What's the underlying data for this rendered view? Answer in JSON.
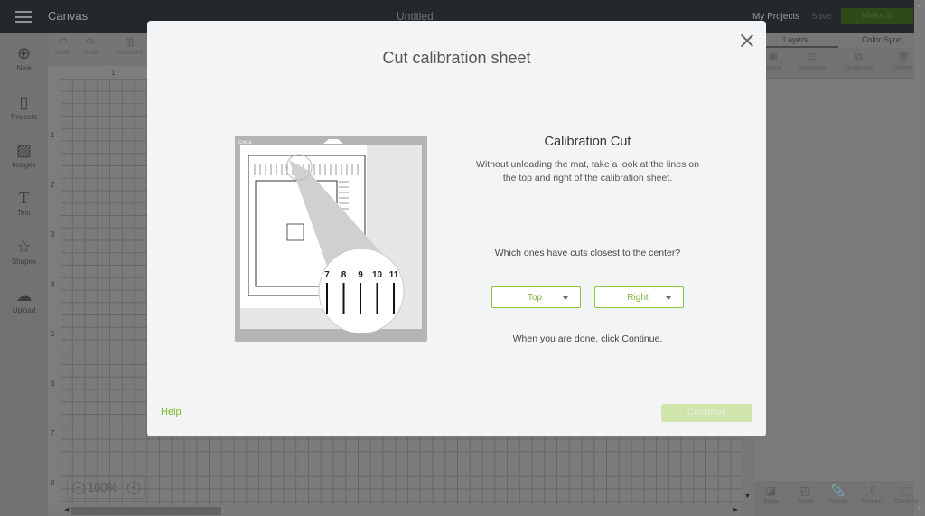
{
  "topbar": {
    "app_title": "Canvas",
    "document_title": "Untitled",
    "my_projects": "My Projects",
    "save": "Save",
    "make_it": "Make It"
  },
  "left_sidebar": {
    "items": [
      {
        "label": "New",
        "icon": "plus-circle-icon"
      },
      {
        "label": "Projects",
        "icon": "notebook-icon"
      },
      {
        "label": "Images",
        "icon": "image-icon"
      },
      {
        "label": "Text",
        "icon": "text-icon"
      },
      {
        "label": "Shapes",
        "icon": "shapes-icon"
      },
      {
        "label": "Upload",
        "icon": "cloud-upload-icon"
      }
    ]
  },
  "toolbar": {
    "undo": "Undo",
    "redo": "Redo",
    "select_all": "Select All"
  },
  "canvas": {
    "ruler_top": [
      "1"
    ],
    "ruler_left": [
      "1",
      "2",
      "3",
      "4",
      "5",
      "6",
      "7",
      "8"
    ],
    "zoom_level": "100%"
  },
  "right_panel": {
    "tabs": [
      "Layers",
      "Color Sync"
    ],
    "active_tab": "Layers",
    "layer_tools": [
      "Group",
      "UnGroup",
      "Duplicate",
      "Delete"
    ],
    "bottom_tools": [
      "Slice",
      "Weld",
      "Attach",
      "Flatten",
      "Contour"
    ]
  },
  "modal": {
    "title": "Cut calibration sheet",
    "illustration": {
      "brand": "Cricut",
      "magnified_numbers": [
        "7",
        "8",
        "9",
        "10",
        "11"
      ]
    },
    "section_title": "Calibration Cut",
    "description": "Without unloading the mat, take a look at the lines on the top and right of the calibration sheet.",
    "question": "Which ones have cuts closest to the center?",
    "dropdown_top": {
      "selected": "Top"
    },
    "dropdown_right": {
      "selected": "Right"
    },
    "done_text": "When you are done, click Continue.",
    "help": "Help",
    "continue": "Continue"
  },
  "colors": {
    "accent_green": "#7ab82a",
    "continue_disabled": "#cfe5ab",
    "topbar_bg": "#24282c",
    "modal_bg": "#f3f4f6"
  }
}
